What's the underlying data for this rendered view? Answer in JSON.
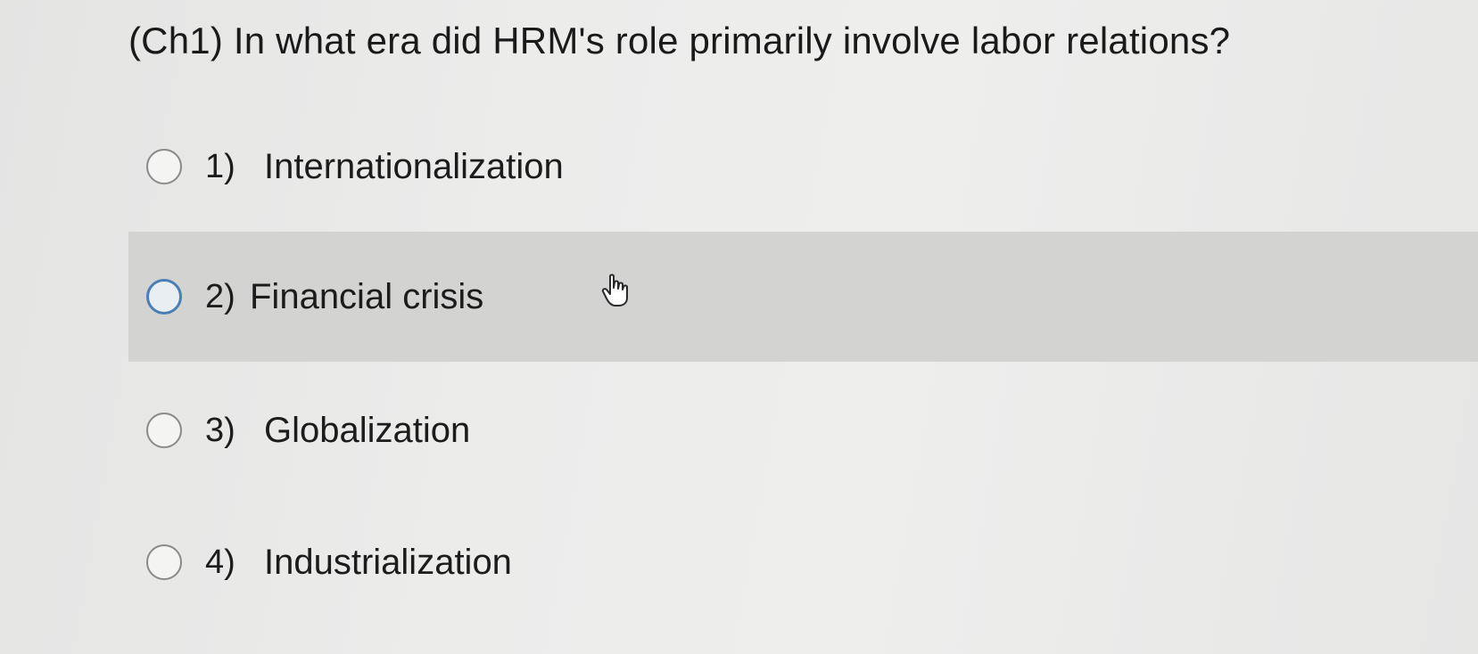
{
  "question": {
    "text": "(Ch1) In what era did HRM's role primarily involve labor relations?"
  },
  "options": [
    {
      "number": "1)",
      "label": "Internationalization",
      "highlighted": false
    },
    {
      "number": "2)",
      "label": "Financial crisis",
      "highlighted": true
    },
    {
      "number": "3)",
      "label": "Globalization",
      "highlighted": false
    },
    {
      "number": "4)",
      "label": "Industrialization",
      "highlighted": false
    }
  ],
  "icons": {
    "radio": "radio-button-icon",
    "cursor": "hand-pointer-cursor-icon"
  },
  "colors": {
    "highlight_row": "#d3d3d2",
    "radio_focus_border": "#4a7fb6"
  }
}
